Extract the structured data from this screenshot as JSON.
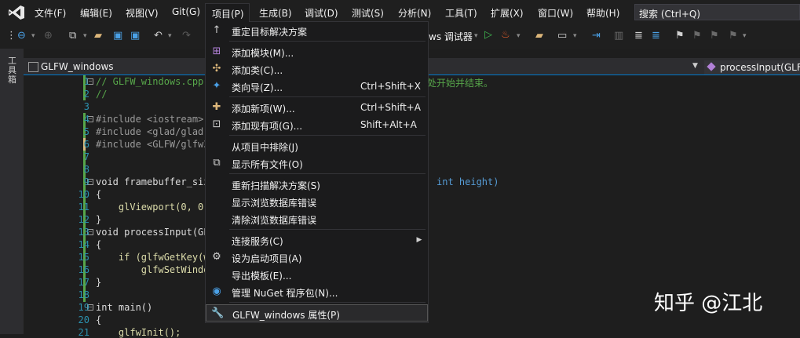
{
  "menubar": {
    "items": [
      "文件(F)",
      "编辑(E)",
      "视图(V)",
      "Git(G)",
      "项目(P)",
      "生成(B)",
      "调试(D)",
      "测试(S)",
      "分析(N)",
      "工具(T)",
      "扩展(X)",
      "窗口(W)",
      "帮助(H)"
    ],
    "search_placeholder": "搜索 (Ctrl+Q)"
  },
  "toolbar": {
    "debugger_label": "ws 调试器"
  },
  "side": {
    "toolbox_label": "工具箱"
  },
  "tab": {
    "file": "GLFW_windows"
  },
  "nav": {
    "member": "processInput(GLFW"
  },
  "editor": {
    "lines": [
      {
        "n": "1",
        "text": "// GLFW_windows.cpp"
      },
      {
        "n": "2",
        "text": "//"
      },
      {
        "n": "3",
        "text": ""
      },
      {
        "n": "4",
        "text": "#include <iostream>"
      },
      {
        "n": "5",
        "text": "#include <glad/glad."
      },
      {
        "n": "6",
        "text": "#include <GLFW/glfw3"
      },
      {
        "n": "7",
        "text": ""
      },
      {
        "n": "8",
        "text": ""
      },
      {
        "n": "9",
        "text": "void framebuffer_siz"
      },
      {
        "n": "10",
        "text": "{"
      },
      {
        "n": "11",
        "text": "    glViewport(0, 0,"
      },
      {
        "n": "12",
        "text": "}"
      },
      {
        "n": "13",
        "text": "void processInput(GL"
      },
      {
        "n": "14",
        "text": "{"
      },
      {
        "n": "15",
        "text": "    if (glfwGetKey(w"
      },
      {
        "n": "16",
        "text": "        glfwSetWindo"
      },
      {
        "n": "17",
        "text": "}"
      },
      {
        "n": "18",
        "text": ""
      },
      {
        "n": "19",
        "text": "int main()"
      },
      {
        "n": "20",
        "text": "{"
      },
      {
        "n": "21",
        "text": "    glfwInit();"
      }
    ],
    "line1_tail": "处开始并结束。",
    "line9_tail": "int height)"
  },
  "dropdown": {
    "items": [
      {
        "label": "重定目标解决方案",
        "shortcut": "",
        "icon": "up-arrow-icon"
      },
      {
        "label": "添加模块(M)...",
        "shortcut": "",
        "icon": "add-module-icon"
      },
      {
        "label": "添加类(C)...",
        "shortcut": "",
        "icon": "add-class-icon"
      },
      {
        "label": "类向导(Z)...",
        "shortcut": "Ctrl+Shift+X",
        "icon": "class-wizard-icon"
      },
      {
        "label": "添加新项(W)...",
        "shortcut": "Ctrl+Shift+A",
        "icon": "add-new-item-icon"
      },
      {
        "label": "添加现有项(G)...",
        "shortcut": "Shift+Alt+A",
        "icon": "add-existing-item-icon"
      },
      {
        "label": "从项目中排除(J)",
        "shortcut": "",
        "icon": ""
      },
      {
        "label": "显示所有文件(O)",
        "shortcut": "",
        "icon": "show-all-files-icon"
      },
      {
        "label": "重新扫描解决方案(S)",
        "shortcut": "",
        "icon": ""
      },
      {
        "label": "显示浏览数据库错误",
        "shortcut": "",
        "icon": ""
      },
      {
        "label": "清除浏览数据库错误",
        "shortcut": "",
        "icon": ""
      },
      {
        "label": "连接服务(C)",
        "shortcut": "",
        "icon": ""
      },
      {
        "label": "设为启动项目(A)",
        "shortcut": "",
        "icon": "gear-icon"
      },
      {
        "label": "导出模板(E)...",
        "shortcut": "",
        "icon": ""
      },
      {
        "label": "管理 NuGet 程序包(N)...",
        "shortcut": "",
        "icon": "nuget-icon"
      },
      {
        "label": "GLFW_windows 属性(P)",
        "shortcut": "",
        "icon": "wrench-icon"
      }
    ]
  },
  "watermark": "知乎 @江北"
}
